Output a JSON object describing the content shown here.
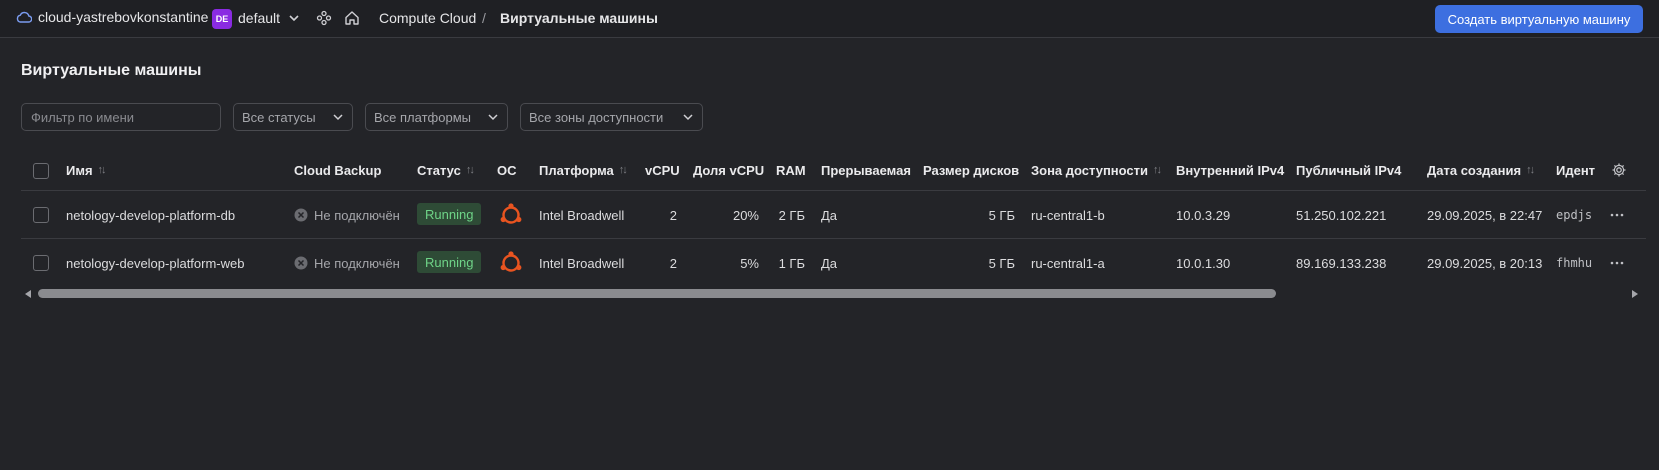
{
  "header": {
    "cloud_name": "cloud-yastrebovkonstantine",
    "folder_badge": "DE",
    "folder_name": "default",
    "breadcrumb_service": "Compute Cloud",
    "breadcrumb_separator": "/",
    "breadcrumb_current": "Виртуальные машины",
    "create_button": "Создать виртуальную машину"
  },
  "page": {
    "title": "Виртуальные машины"
  },
  "filters": {
    "name_placeholder": "Фильтр по имени",
    "status_select": "Все статусы",
    "platform_select": "Все платформы",
    "zone_select": "Все зоны доступности"
  },
  "table": {
    "columns": {
      "name": "Имя",
      "backup": "Cloud Backup",
      "status": "Статус",
      "os": "ОС",
      "platform": "Платформа",
      "vcpu": "vCPU",
      "vcpu_share": "Доля vCPU",
      "ram": "RAM",
      "preemptible": "Прерываемая",
      "disk_size": "Размер дисков",
      "zone": "Зона доступности",
      "internal_ip": "Внутренний IPv4",
      "public_ip": "Публичный IPv4",
      "created": "Дата создания",
      "id": "Идент"
    },
    "sort_glyph": "↑↓",
    "rows": [
      {
        "name": "netology-develop-platform-db",
        "backup": "Не подключён",
        "status": "Running",
        "os_icon": "ubuntu-icon",
        "platform": "Intel Broadwell",
        "vcpu": "2",
        "vcpu_share": "20%",
        "ram": "2 ГБ",
        "preemptible": "Да",
        "disk_size": "5 ГБ",
        "zone": "ru-central1-b",
        "internal_ip": "10.0.3.29",
        "public_ip": "51.250.102.221",
        "created": "29.09.2025, в 22:47",
        "id": "epdjs"
      },
      {
        "name": "netology-develop-platform-web",
        "backup": "Не подключён",
        "status": "Running",
        "os_icon": "ubuntu-icon",
        "platform": "Intel Broadwell",
        "vcpu": "2",
        "vcpu_share": "5%",
        "ram": "1 ГБ",
        "preemptible": "Да",
        "disk_size": "5 ГБ",
        "zone": "ru-central1-a",
        "internal_ip": "10.0.1.30",
        "public_ip": "89.169.133.238",
        "created": "29.09.2025, в 20:13",
        "id": "fhmhu"
      }
    ]
  },
  "colors": {
    "background": "#232428",
    "accent_button": "#3d6fe0",
    "status_running_bg": "#2e4b36",
    "status_running_text": "#6fd488",
    "folder_badge": "#8a2be2",
    "ubuntu": "#e95420"
  }
}
